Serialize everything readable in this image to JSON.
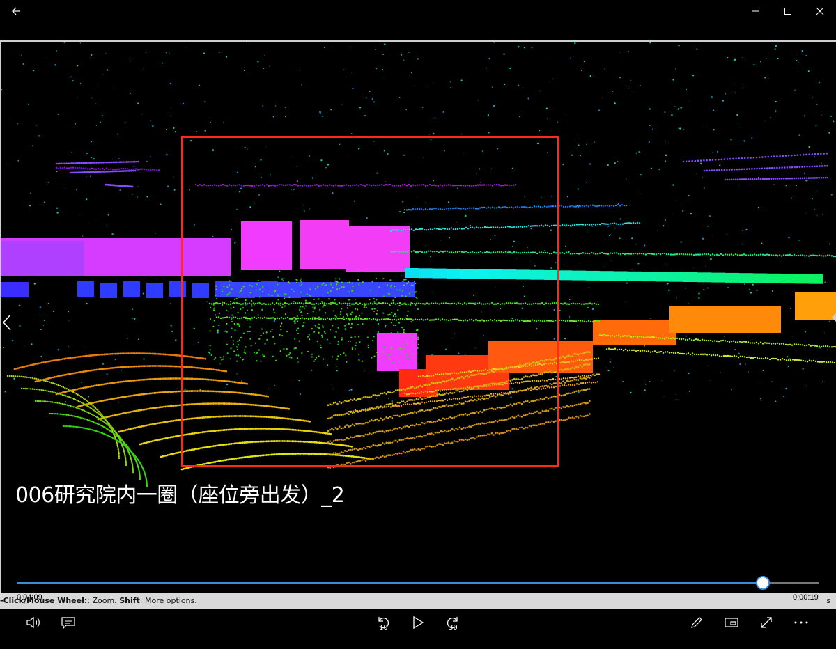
{
  "window": {
    "back_icon": "back-arrow-icon",
    "minimize_icon": "minimize-icon",
    "maximize_icon": "maximize-icon",
    "close_icon": "close-icon"
  },
  "video": {
    "title": "006研究院内一圈（座位旁出发）_2",
    "hint_prefix": "-Click/Mouse Wheel:",
    "hint_zoom": ": Zoom. ",
    "hint_shift": "Shift",
    "hint_more": ": More options.",
    "hint_right": "s"
  },
  "player": {
    "current_time": "0:04:09",
    "remaining_time": "0:00:19",
    "progress": 0.93,
    "skip_back": "10",
    "skip_forward": "30"
  },
  "colors": {
    "accent": "#3b8ede",
    "highlight_box": "#ff2a1a"
  }
}
